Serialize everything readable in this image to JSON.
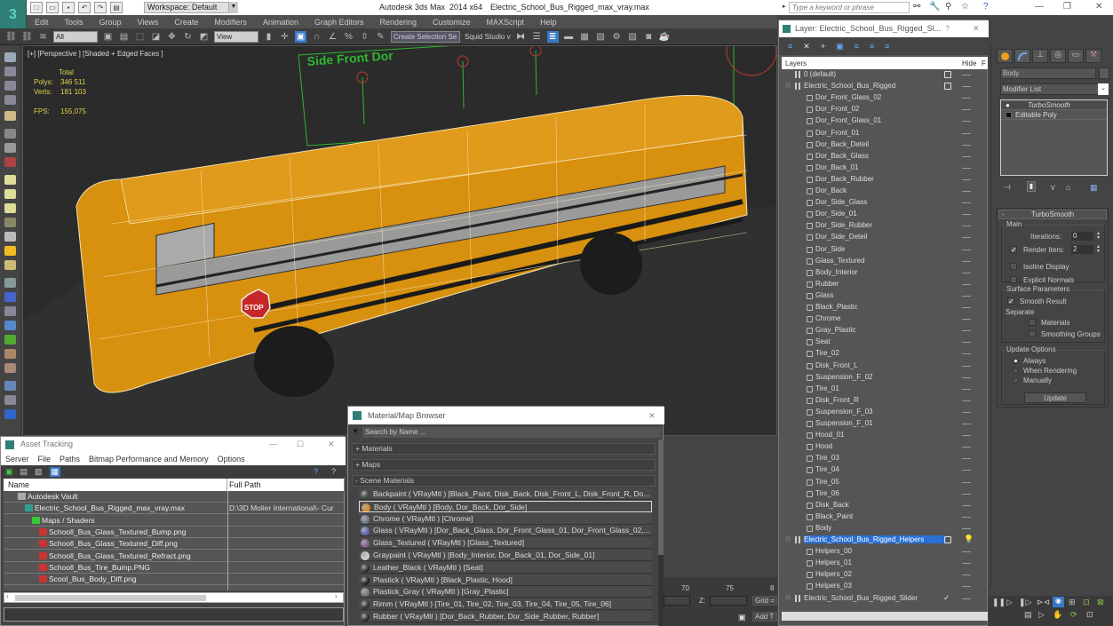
{
  "app": {
    "title": "Autodesk 3ds Max  2014 x64",
    "file": "Electric_School_Bus_Rigged_max_vray.max",
    "workspace": "Workspace: Default",
    "search_placeholder": "Type a keyword or phrase"
  },
  "menubar": [
    "Edit",
    "Tools",
    "Group",
    "Views",
    "Create",
    "Modifiers",
    "Animation",
    "Graph Editors",
    "Rendering",
    "Customize",
    "MAXScript",
    "Help"
  ],
  "toolbar": {
    "selection_filter": "All",
    "ref_coord": "View",
    "named_selection": "Create Selection Se",
    "squid_label": "Squid Studio v"
  },
  "viewport": {
    "label": "[+] [Perspective ] [Shaded + Edged Faces ]",
    "stats": {
      "header": "Total",
      "polys_label": "Polys:",
      "polys": "346 511",
      "verts_label": "Verts:",
      "verts": "181 103",
      "fps_label": "FPS:",
      "fps": "155,075"
    },
    "scene_text": "Side Front Dor",
    "stop_sign": "STOP"
  },
  "layer_panel": {
    "title": "Layer: Electric_School_Bus_Rigged_Sl...",
    "help": "?",
    "col_layers": "Layers",
    "col_hide": "Hide",
    "col_f": "F",
    "rows": [
      {
        "name": "0 (default)",
        "type": "layer",
        "level": 0,
        "checkbox": true
      },
      {
        "name": "Electric_School_Bus_Rigged",
        "type": "layer",
        "level": 0,
        "checkbox": true,
        "expand": true
      },
      {
        "name": "Dor_Front_Glass_02",
        "type": "object",
        "level": 1
      },
      {
        "name": "Dor_Front_02",
        "type": "object",
        "level": 1
      },
      {
        "name": "Dor_Front_Glass_01",
        "type": "object",
        "level": 1
      },
      {
        "name": "Dor_Front_01",
        "type": "object",
        "level": 1
      },
      {
        "name": "Dor_Back_Deteil",
        "type": "object",
        "level": 1
      },
      {
        "name": "Dor_Back_Glass",
        "type": "object",
        "level": 1
      },
      {
        "name": "Dor_Back_01",
        "type": "object",
        "level": 1
      },
      {
        "name": "Dor_Back_Rubber",
        "type": "object",
        "level": 1
      },
      {
        "name": "Dor_Back",
        "type": "object",
        "level": 1
      },
      {
        "name": "Dor_Side_Glass",
        "type": "object",
        "level": 1
      },
      {
        "name": "Dor_Side_01",
        "type": "object",
        "level": 1
      },
      {
        "name": "Dor_Side_Rubber",
        "type": "object",
        "level": 1
      },
      {
        "name": "Dor_Side_Deteil",
        "type": "object",
        "level": 1
      },
      {
        "name": "Dor_Side",
        "type": "object",
        "level": 1
      },
      {
        "name": "Glass_Textured",
        "type": "object",
        "level": 1
      },
      {
        "name": "Body_Interior",
        "type": "object",
        "level": 1
      },
      {
        "name": "Rubber",
        "type": "object",
        "level": 1
      },
      {
        "name": "Glass",
        "type": "object",
        "level": 1
      },
      {
        "name": "Black_Plastic",
        "type": "object",
        "level": 1
      },
      {
        "name": "Chrome",
        "type": "object",
        "level": 1
      },
      {
        "name": "Gray_Plastic",
        "type": "object",
        "level": 1
      },
      {
        "name": "Seat",
        "type": "object",
        "level": 1
      },
      {
        "name": "Tire_02",
        "type": "object",
        "level": 1
      },
      {
        "name": "Disk_Front_L",
        "type": "object",
        "level": 1
      },
      {
        "name": "Suspension_F_02",
        "type": "object",
        "level": 1
      },
      {
        "name": "Tire_01",
        "type": "object",
        "level": 1
      },
      {
        "name": "Disk_Front_R",
        "type": "object",
        "level": 1
      },
      {
        "name": "Suspension_F_03",
        "type": "object",
        "level": 1
      },
      {
        "name": "Suspension_F_01",
        "type": "object",
        "level": 1
      },
      {
        "name": "Hood_01",
        "type": "object",
        "level": 1
      },
      {
        "name": "Hood",
        "type": "object",
        "level": 1
      },
      {
        "name": "Tire_03",
        "type": "object",
        "level": 1
      },
      {
        "name": "Tire_04",
        "type": "object",
        "level": 1
      },
      {
        "name": "Tire_05",
        "type": "object",
        "level": 1
      },
      {
        "name": "Tire_06",
        "type": "object",
        "level": 1
      },
      {
        "name": "Disk_Back",
        "type": "object",
        "level": 1
      },
      {
        "name": "Black_Paint",
        "type": "object",
        "level": 1
      },
      {
        "name": "Body",
        "type": "object",
        "level": 1
      },
      {
        "name": "Electric_School_Bus_Rigged_Helpers",
        "type": "layer",
        "level": 0,
        "checkbox": true,
        "selected": true,
        "expand": true,
        "light": true
      },
      {
        "name": "Helpers_00",
        "type": "object",
        "level": 1
      },
      {
        "name": "Helpers_01",
        "type": "object",
        "level": 1
      },
      {
        "name": "Helpers_02",
        "type": "object",
        "level": 1
      },
      {
        "name": "Helpers_03",
        "type": "object",
        "level": 1
      },
      {
        "name": "Electric_School_Bus_Rigged_Slider",
        "type": "layer",
        "level": 0,
        "check": true,
        "expand": true
      }
    ]
  },
  "command_panel": {
    "object_name": "Body",
    "modifier_list": "Modifier List",
    "stack": [
      "TurboSmooth",
      "Editable Poly"
    ],
    "rollout_title": "TurboSmooth",
    "main_group": "Main",
    "iterations_label": "Iterations:",
    "iterations": "0",
    "render_iters_label": "Render Iters:",
    "render_iters": "2",
    "render_iters_checked": true,
    "isoline_label": "Isoline Display",
    "isoline_checked": false,
    "explicit_label": "Explicit Normals",
    "explicit_checked": false,
    "surface_group": "Surface Parameters",
    "smooth_result_label": "Smooth Result",
    "smooth_result_checked": true,
    "separate_label": "Separate",
    "materials_label": "Materials",
    "materials_checked": false,
    "smoothing_groups_label": "Smoothing Groups",
    "smoothing_groups_checked": false,
    "update_group": "Update Options",
    "update_options": [
      "Always",
      "When Rendering",
      "Manually"
    ],
    "update_selected": "Always",
    "update_button": "Update"
  },
  "asset_tracking": {
    "title": "Asset Tracking",
    "menu": [
      "Server",
      "File",
      "Paths",
      "Bitmap Performance and Memory",
      "Options"
    ],
    "col_name": "Name",
    "col_path": "Full Path",
    "rows": [
      {
        "name": "Autodesk Vault",
        "path": "",
        "level": 1,
        "icon": "vault"
      },
      {
        "name": "Electric_School_Bus_Rigged_max_vray.max",
        "path": "D:\\3D Molier International\\- Cur",
        "level": 2,
        "icon": "max"
      },
      {
        "name": "Maps / Shaders",
        "path": "",
        "level": 3,
        "icon": "maps"
      },
      {
        "name": "Schooll_Bus_Glass_Textured_Bump.png",
        "path": "",
        "level": 4,
        "icon": "png"
      },
      {
        "name": "Schooll_Bus_Glass_Textured_Diff.png",
        "path": "",
        "level": 4,
        "icon": "png"
      },
      {
        "name": "Schooll_Bus_Glass_Textured_Refract.png",
        "path": "",
        "level": 4,
        "icon": "png"
      },
      {
        "name": "Schooll_Bus_Tire_Bump.PNG",
        "path": "",
        "level": 4,
        "icon": "png"
      },
      {
        "name": "Scool_Bus_Body_Diff.png",
        "path": "",
        "level": 4,
        "icon": "png"
      }
    ]
  },
  "material_browser": {
    "title": "Material/Map Browser",
    "search_placeholder": "Search by Name ...",
    "sections": [
      "+ Materials",
      "+ Maps",
      "- Scene Materials"
    ],
    "materials": [
      {
        "text": "Backpaint  ( VRayMtl ) [Black_Paint, Disk_Back, Disk_Front_L, Disk_Front_R, Do...",
        "ball": "#3a4a3a"
      },
      {
        "text": "Body  ( VRayMtl ) [Body, Dor_Back, Dor_Side]",
        "ball": "#d98a1a",
        "selected": true
      },
      {
        "text": "Chrome  ( VRayMtl ) [Chrome]",
        "ball": "#6a7a8a"
      },
      {
        "text": "Glass  ( VRayMtl ) [Dor_Back_Glass, Dor_Front_Glass_01, Dor_Front_Glass_02,...",
        "ball": "#5a6ab0"
      },
      {
        "text": "Glass_Textured  ( VRayMtl ) [Glass_Textured]",
        "ball": "#7a5a8a"
      },
      {
        "text": "Graypaint  ( VRayMtl ) [Body_Interior, Dor_Back_01, Dor_Side_01]",
        "ball": "#d0d0d0"
      },
      {
        "text": "Leather_Black  ( VRayMtl ) [Seat]",
        "ball": "#2a2a2a"
      },
      {
        "text": "Plastick  ( VRayMtl ) [Black_Plastic, Hood]",
        "ball": "#1e1e1e"
      },
      {
        "text": "Plastick_Gray  ( VRayMtl ) [Gray_Plastic]",
        "ball": "#777777"
      },
      {
        "text": "Rimm  ( VRayMtl ) [Tire_01, Tire_02, Tire_03, Tire_04, Tire_05, Tire_06]",
        "ball": "#2e2e2e"
      },
      {
        "text": "Rubber  ( VRayMtl ) [Dor_Back_Rubber, Dor_Side_Rubber, Rubber]",
        "ball": "#262626"
      }
    ]
  },
  "timeline": {
    "ticks": [
      "70",
      "75",
      "8"
    ]
  },
  "status": {
    "z_label": "Z:",
    "grid_label": "Grid =",
    "add_time_tag": "Add T"
  },
  "colors": {
    "bus_body": "#d8900f",
    "selection_blue": "#2a6fd4",
    "stats_yellow": "#e0d24a",
    "helper_green": "#2fb52f"
  }
}
